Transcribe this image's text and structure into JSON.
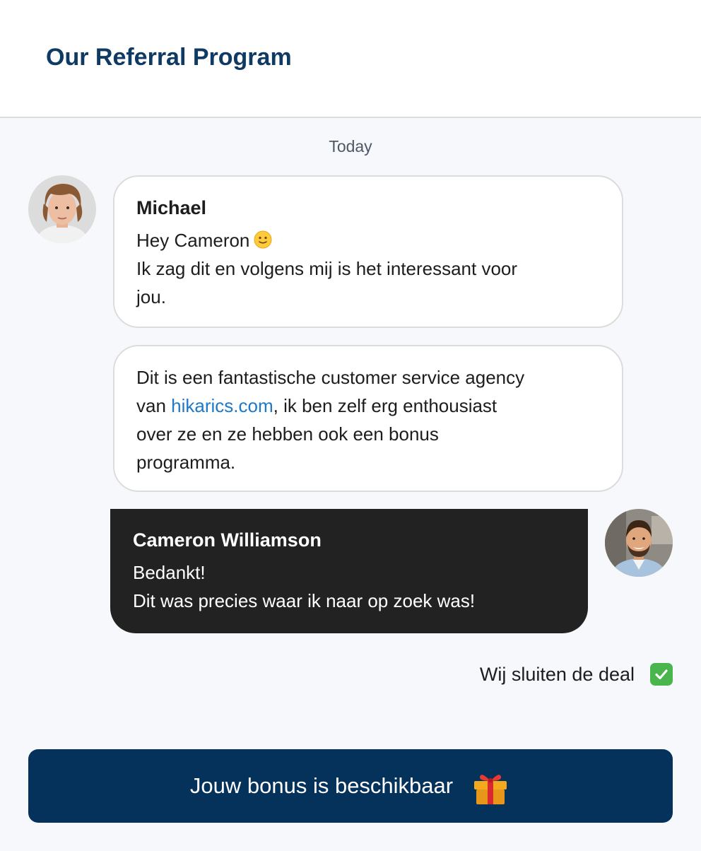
{
  "header": {
    "title": "Our Referral Program"
  },
  "chat": {
    "date_label": "Today",
    "messages": [
      {
        "sender": "Michael",
        "lines": [
          "Hey Cameron",
          "Ik zag dit en volgens mij is het interessant voor",
          "jou."
        ],
        "avatar_icon": "avatar-michael"
      },
      {
        "line1_prefix": "Dit is een fantastische customer service agency",
        "line2_prefix": "van ",
        "link_text": "hikarics.com",
        "line2_suffix": ", ik ben zelf erg enthousiast",
        "line3": "over ze en ze hebben ook een bonus",
        "line4": "programma."
      },
      {
        "sender": "Cameron Williamson",
        "lines": [
          "Bedankt!",
          "Dit was precies waar ik naar op zoek was!"
        ],
        "avatar_icon": "avatar-cameron"
      }
    ],
    "status_text": "Wij sluiten de deal",
    "status_icon": "check-mark-icon"
  },
  "cta": {
    "label": "Jouw bonus is beschikbaar",
    "icon": "gift-icon"
  },
  "colors": {
    "brand": "#04325a",
    "title": "#0e3a63",
    "link": "#1f78c8",
    "dark_bubble": "#222222",
    "check": "#49b54c"
  }
}
